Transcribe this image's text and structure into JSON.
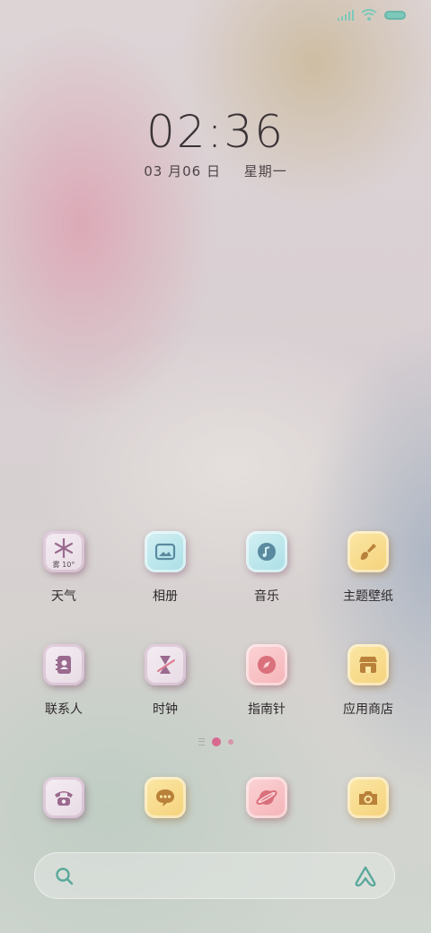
{
  "clock": {
    "time": "02:36",
    "date": "03 月06 日",
    "weekday": "星期一"
  },
  "weather_widget": {
    "condition": "雾",
    "temp": "10°"
  },
  "apps_row1": [
    {
      "label": "天气",
      "icon": "snowflake-icon"
    },
    {
      "label": "相册",
      "icon": "image-icon"
    },
    {
      "label": "音乐",
      "icon": "music-note-icon"
    },
    {
      "label": "主题壁纸",
      "icon": "paint-brush-icon"
    }
  ],
  "apps_row2": [
    {
      "label": "联系人",
      "icon": "contact-book-icon"
    },
    {
      "label": "时钟",
      "icon": "hourglass-icon"
    },
    {
      "label": "指南针",
      "icon": "compass-icon"
    },
    {
      "label": "应用商店",
      "icon": "store-icon"
    }
  ],
  "dock": [
    {
      "name": "phone",
      "icon": "telephone-icon"
    },
    {
      "name": "messages",
      "icon": "chat-bubble-icon"
    },
    {
      "name": "browser",
      "icon": "planet-icon"
    },
    {
      "name": "camera",
      "icon": "camera-icon"
    }
  ],
  "colors": {
    "accent": "#d8698e",
    "teal": "#5aa99b",
    "battery": "#7cc8bb"
  }
}
